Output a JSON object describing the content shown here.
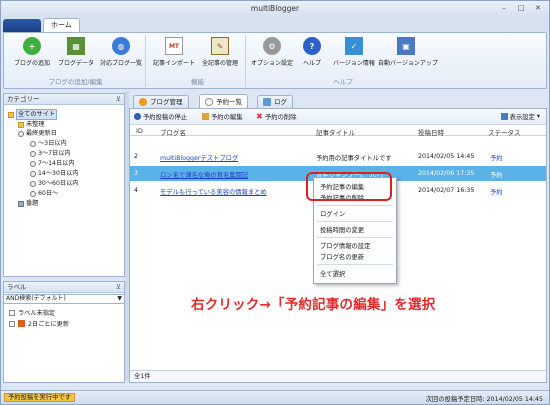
{
  "window": {
    "title": "multiBlogger",
    "controls": [
      "–",
      "□",
      "✕"
    ]
  },
  "ribbon_tab": "ホーム",
  "ribbon": {
    "groups": [
      {
        "caption": "ブログの追加/編集",
        "buttons": [
          {
            "label": "ブログの追加",
            "icon": "add-icon",
            "color": "#3fae3f"
          },
          {
            "label": "ブログデータ",
            "icon": "data-icon",
            "color": "#5a8f3a"
          },
          {
            "label": "対応ブログ一覧",
            "icon": "globe-icon",
            "color": "#3c7bd6"
          }
        ]
      },
      {
        "caption": "機能",
        "buttons": [
          {
            "label": "記事インポート",
            "icon": "mt-import-icon",
            "color": "#c33"
          },
          {
            "label": "全記事の管理",
            "icon": "article-manage-icon",
            "color": "#8a6a2c"
          }
        ]
      },
      {
        "caption": "ヘルプ",
        "buttons": [
          {
            "label": "オプション設定",
            "icon": "gear-icon",
            "color": "#888"
          },
          {
            "label": "ヘルプ",
            "icon": "help-icon",
            "color": "#2d62c8"
          },
          {
            "label": "バージョン情報",
            "icon": "version-icon",
            "color": "#3a8ed4"
          },
          {
            "label": "自動バージョンアップ",
            "icon": "auto-update-icon",
            "color": "#d44"
          }
        ]
      }
    ]
  },
  "category_panel": {
    "title": "カテゴリー",
    "items": [
      {
        "label": "全てのサイト",
        "icon": "folder-icon"
      },
      {
        "label": "未整理",
        "icon": "folder-icon"
      },
      {
        "label": "最終更新日",
        "icon": "clock-icon"
      },
      {
        "label": "～3日以内",
        "icon": "clock-icon"
      },
      {
        "label": "3～7日以内",
        "icon": "clock-icon"
      },
      {
        "label": "7～14日以内",
        "icon": "clock-icon"
      },
      {
        "label": "14～30日以内",
        "icon": "clock-icon"
      },
      {
        "label": "30～60日以内",
        "icon": "clock-icon"
      },
      {
        "label": "60日～",
        "icon": "clock-icon"
      },
      {
        "label": "番題",
        "icon": "trash-icon"
      }
    ]
  },
  "label_panel": {
    "title": "ラベル",
    "dropdown": "AND検索(デフォルト)",
    "items": [
      {
        "label": "ラベル未指定"
      },
      {
        "label": "2日ごとに更新"
      }
    ]
  },
  "doc_tabs": [
    {
      "label": "ブログ管理",
      "color": "#f29a1f"
    },
    {
      "label": "予約一覧",
      "color": "#8a8f99"
    },
    {
      "label": "ログ",
      "color": "#5b9bd5"
    }
  ],
  "toolbar": {
    "stop": "予約投稿の停止",
    "edit": "予約の編集",
    "delete": "予約の削除",
    "display": "表示設定"
  },
  "table": {
    "headers": [
      "ID",
      "ブログ名",
      "記事タイトル",
      "投稿日時",
      "ステータス"
    ],
    "rows": [
      {
        "id": "2",
        "blog": "multiBloggerテストブログ",
        "title": "予約用の記事タイトルです",
        "date": "2014/02/05 14:45",
        "status": "予約"
      },
      {
        "id": "3",
        "blog": "ロン毛で薄毛な俺の育毛奮闘記",
        "title": "育毛シャンプーについて",
        "date": "2014/02/06 17:35",
        "status": "予約"
      },
      {
        "id": "4",
        "blog": "モデルも行っている美容の情報まとめ",
        "title": "私が",
        "date": "2014/02/07 16:35",
        "status": "予約"
      }
    ],
    "footer": "全1件"
  },
  "context_menu": {
    "items": [
      "予約記事の編集",
      "予約記事の削除",
      "ログイン",
      "投稿時間の変更",
      "ブログ情報の設定",
      "ブログ名の更新",
      "全て選択"
    ]
  },
  "annotation": "右クリック→「予約記事の編集」を選択",
  "statusbar": {
    "running": "予約投稿を実行中です",
    "next": "次回の投稿予定日時: 2014/02/05 14:45"
  }
}
